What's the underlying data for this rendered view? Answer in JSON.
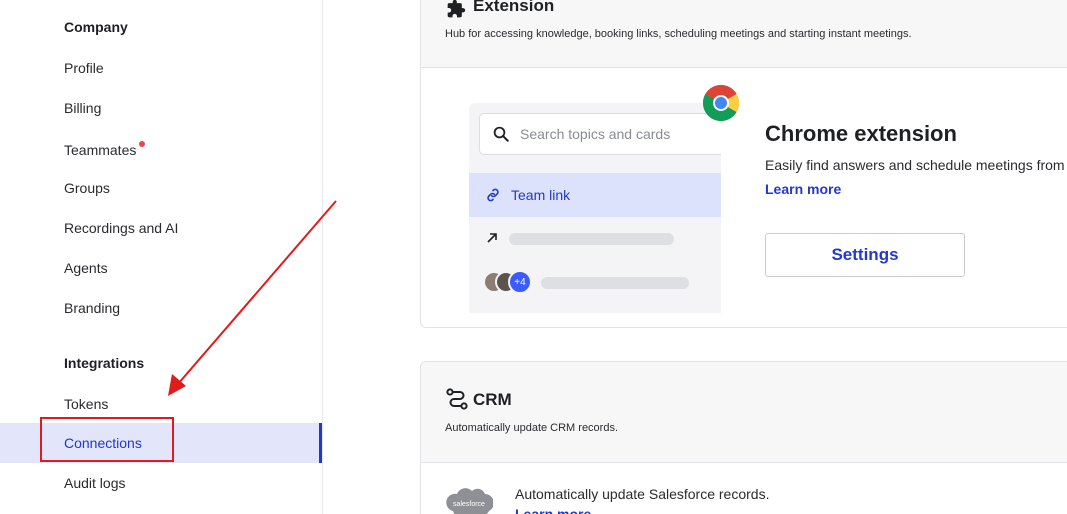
{
  "sidebar": {
    "company_heading": "Company",
    "company_items": [
      {
        "label": "Profile"
      },
      {
        "label": "Billing"
      },
      {
        "label": "Teammates",
        "has_notification": true
      },
      {
        "label": "Groups"
      },
      {
        "label": "Recordings and AI"
      },
      {
        "label": "Agents"
      },
      {
        "label": "Branding"
      }
    ],
    "integrations_heading": "Integrations",
    "integrations_items": [
      {
        "label": "Tokens"
      },
      {
        "label": "Connections",
        "active": true
      },
      {
        "label": "Audit logs"
      }
    ]
  },
  "extension_card": {
    "title": "Extension",
    "description": "Hub for accessing knowledge, booking links, scheduling meetings and starting instant meetings.",
    "preview": {
      "search_placeholder": "Search topics and cards",
      "team_link_label": "Team link",
      "avatar_extra_count": "+4"
    },
    "chrome": {
      "title": "Chrome extension",
      "description": "Easily find answers and schedule meetings from",
      "learn_more": "Learn more",
      "settings_button": "Settings"
    }
  },
  "crm_card": {
    "title": "CRM",
    "description": "Automatically update CRM records.",
    "salesforce": {
      "logo_text": "salesforce",
      "description": "Automatically update Salesforce records.",
      "learn_more": "Learn more"
    }
  },
  "colors": {
    "accent": "#2239c9",
    "active_bg": "#e3e6fb",
    "annotation_red": "#e01b1b",
    "notification_dot": "#e5484d",
    "salesforce_cloud": "#8e9096"
  }
}
